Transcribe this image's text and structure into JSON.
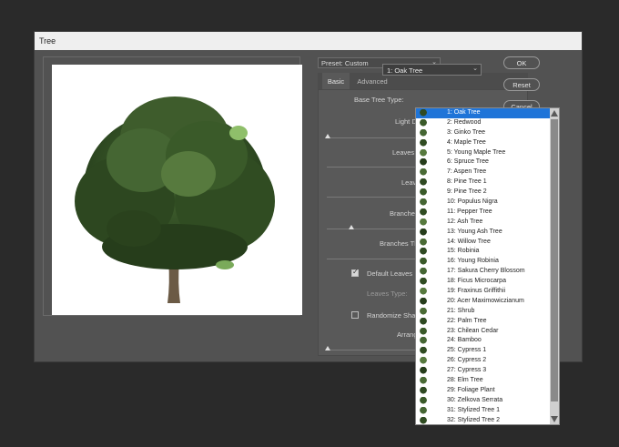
{
  "window": {
    "title": "Tree"
  },
  "preset": {
    "label": "Preset: Custom"
  },
  "tabs": [
    {
      "label": "Basic"
    },
    {
      "label": "Advanced"
    }
  ],
  "basic": {
    "base_tree_type_label": "Base Tree Type:",
    "base_tree_type_value": "1: Oak Tree",
    "light_direction_label": "Light D",
    "leaves_amount_label": "Leaves A",
    "leaves_size_label": "Leav",
    "branches_height_label": "Branches",
    "branches_thickness_label": "Branches Th",
    "default_leaves_label": "Default Leaves",
    "default_leaves_checked": true,
    "leaves_type_label": "Leaves Type:",
    "randomize_shapes_label": "Randomize Shape",
    "randomize_shapes_checked": false,
    "arrangement_label": "Arrang"
  },
  "buttons": {
    "ok": "OK",
    "reset": "Reset",
    "cancel": "Cancel"
  },
  "tree_types": [
    "1: Oak Tree",
    "2: Redwood",
    "3: Ginko Tree",
    "4: Maple Tree",
    "5: Young Maple Tree",
    "6: Spruce Tree",
    "7: Aspen Tree",
    "8: Pine Tree 1",
    "9: Pine Tree 2",
    "10: Populus Nigra",
    "11: Pepper Tree",
    "12: Ash Tree",
    "13: Young Ash Tree",
    "14: Willow Tree",
    "15: Robinia",
    "16: Young Robinia",
    "17: Sakura Cherry Blossom",
    "18: Ficus Microcarpa",
    "19: Fraxinus Griffithii",
    "20: Acer Maximowiczianum",
    "21: Shrub",
    "22: Palm Tree",
    "23: Chilean Cedar",
    "24: Bamboo",
    "25: Cypress 1",
    "26: Cypress 2",
    "27: Cypress 3",
    "28: Elm Tree",
    "29: Foliage Plant",
    "30: Zelkova Serrata",
    "31: Stylized Tree 1",
    "32: Stylized Tree 2"
  ],
  "colors": {
    "selected": "#1f74d8",
    "dialog": "#525252",
    "panel": "#595959"
  }
}
